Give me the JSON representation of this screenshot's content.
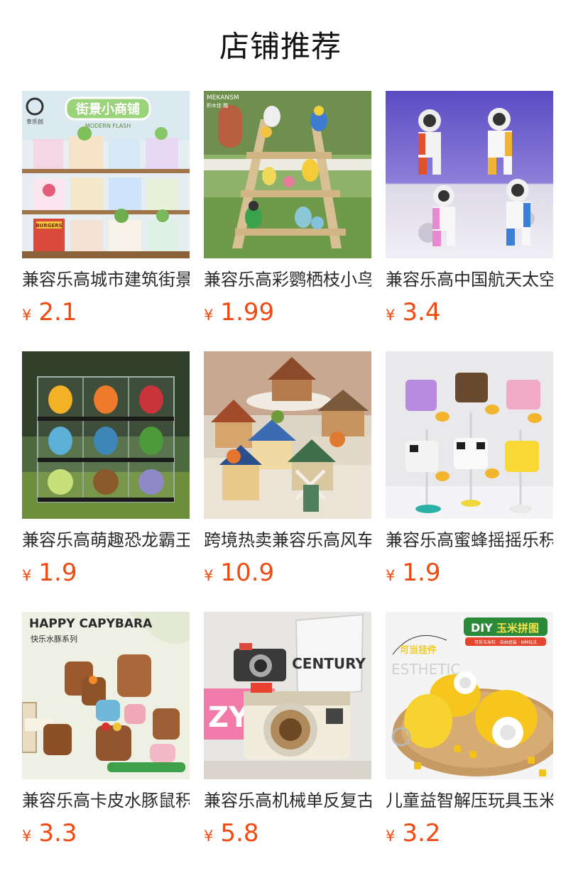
{
  "header": {
    "title": "店铺推荐"
  },
  "currency": "¥",
  "theme": {
    "price_color": "#f04a12"
  },
  "products": [
    {
      "name": "兼容乐高城市建筑街景小商铺",
      "price": "2.1",
      "image": "street-shop-blocks-image"
    },
    {
      "name": "兼容乐高彩鹦栖枝小鸟积木",
      "price": "1.99",
      "image": "parrot-perch-blocks-image"
    },
    {
      "name": "兼容乐高中国航天太空人",
      "price": "3.4",
      "image": "astronaut-blocks-image"
    },
    {
      "name": "兼容乐高萌趣恐龙霸王龙",
      "price": "1.9",
      "image": "cute-dinosaur-blocks-image"
    },
    {
      "name": "跨境热卖兼容乐高风车小屋",
      "price": "10.9",
      "image": "windmill-house-blocks-image"
    },
    {
      "name": "兼容乐高蜜蜂摇摇乐积木",
      "price": "1.9",
      "image": "bee-bobblehead-blocks-image"
    },
    {
      "name": "兼容乐高卡皮水豚鼠积木",
      "price": "3.3",
      "image": "capybara-blocks-image"
    },
    {
      "name": "兼容乐高机械单反复古相机",
      "price": "5.8",
      "image": "retro-camera-blocks-image"
    },
    {
      "name": "儿童益智解压玩具玉米拼图",
      "price": "3.2",
      "image": "corn-puzzle-image"
    }
  ],
  "image_labels": {
    "shop_brand": "幸乐创",
    "shop_banner": "街景小商铺",
    "shop_banner_en": "MODERN FLASH",
    "shop_burger": "BURGERS",
    "parrot_brand": "MEKANSM",
    "parrot_brand_cn": "积木佳 酷",
    "capy_title": "HAPPY CAPYBARA",
    "capy_subtitle": "快乐水豚系列",
    "camera_book": "CENTURY",
    "camera_zy": "ZY",
    "corn_title_diy": "DIY",
    "corn_title_cn": "玉米拼图",
    "corn_sub": "可拆玉米粒 · 自由组装 · N种玩法",
    "corn_tag": "可当挂件",
    "corn_bg_text": "ESTHETIC"
  }
}
